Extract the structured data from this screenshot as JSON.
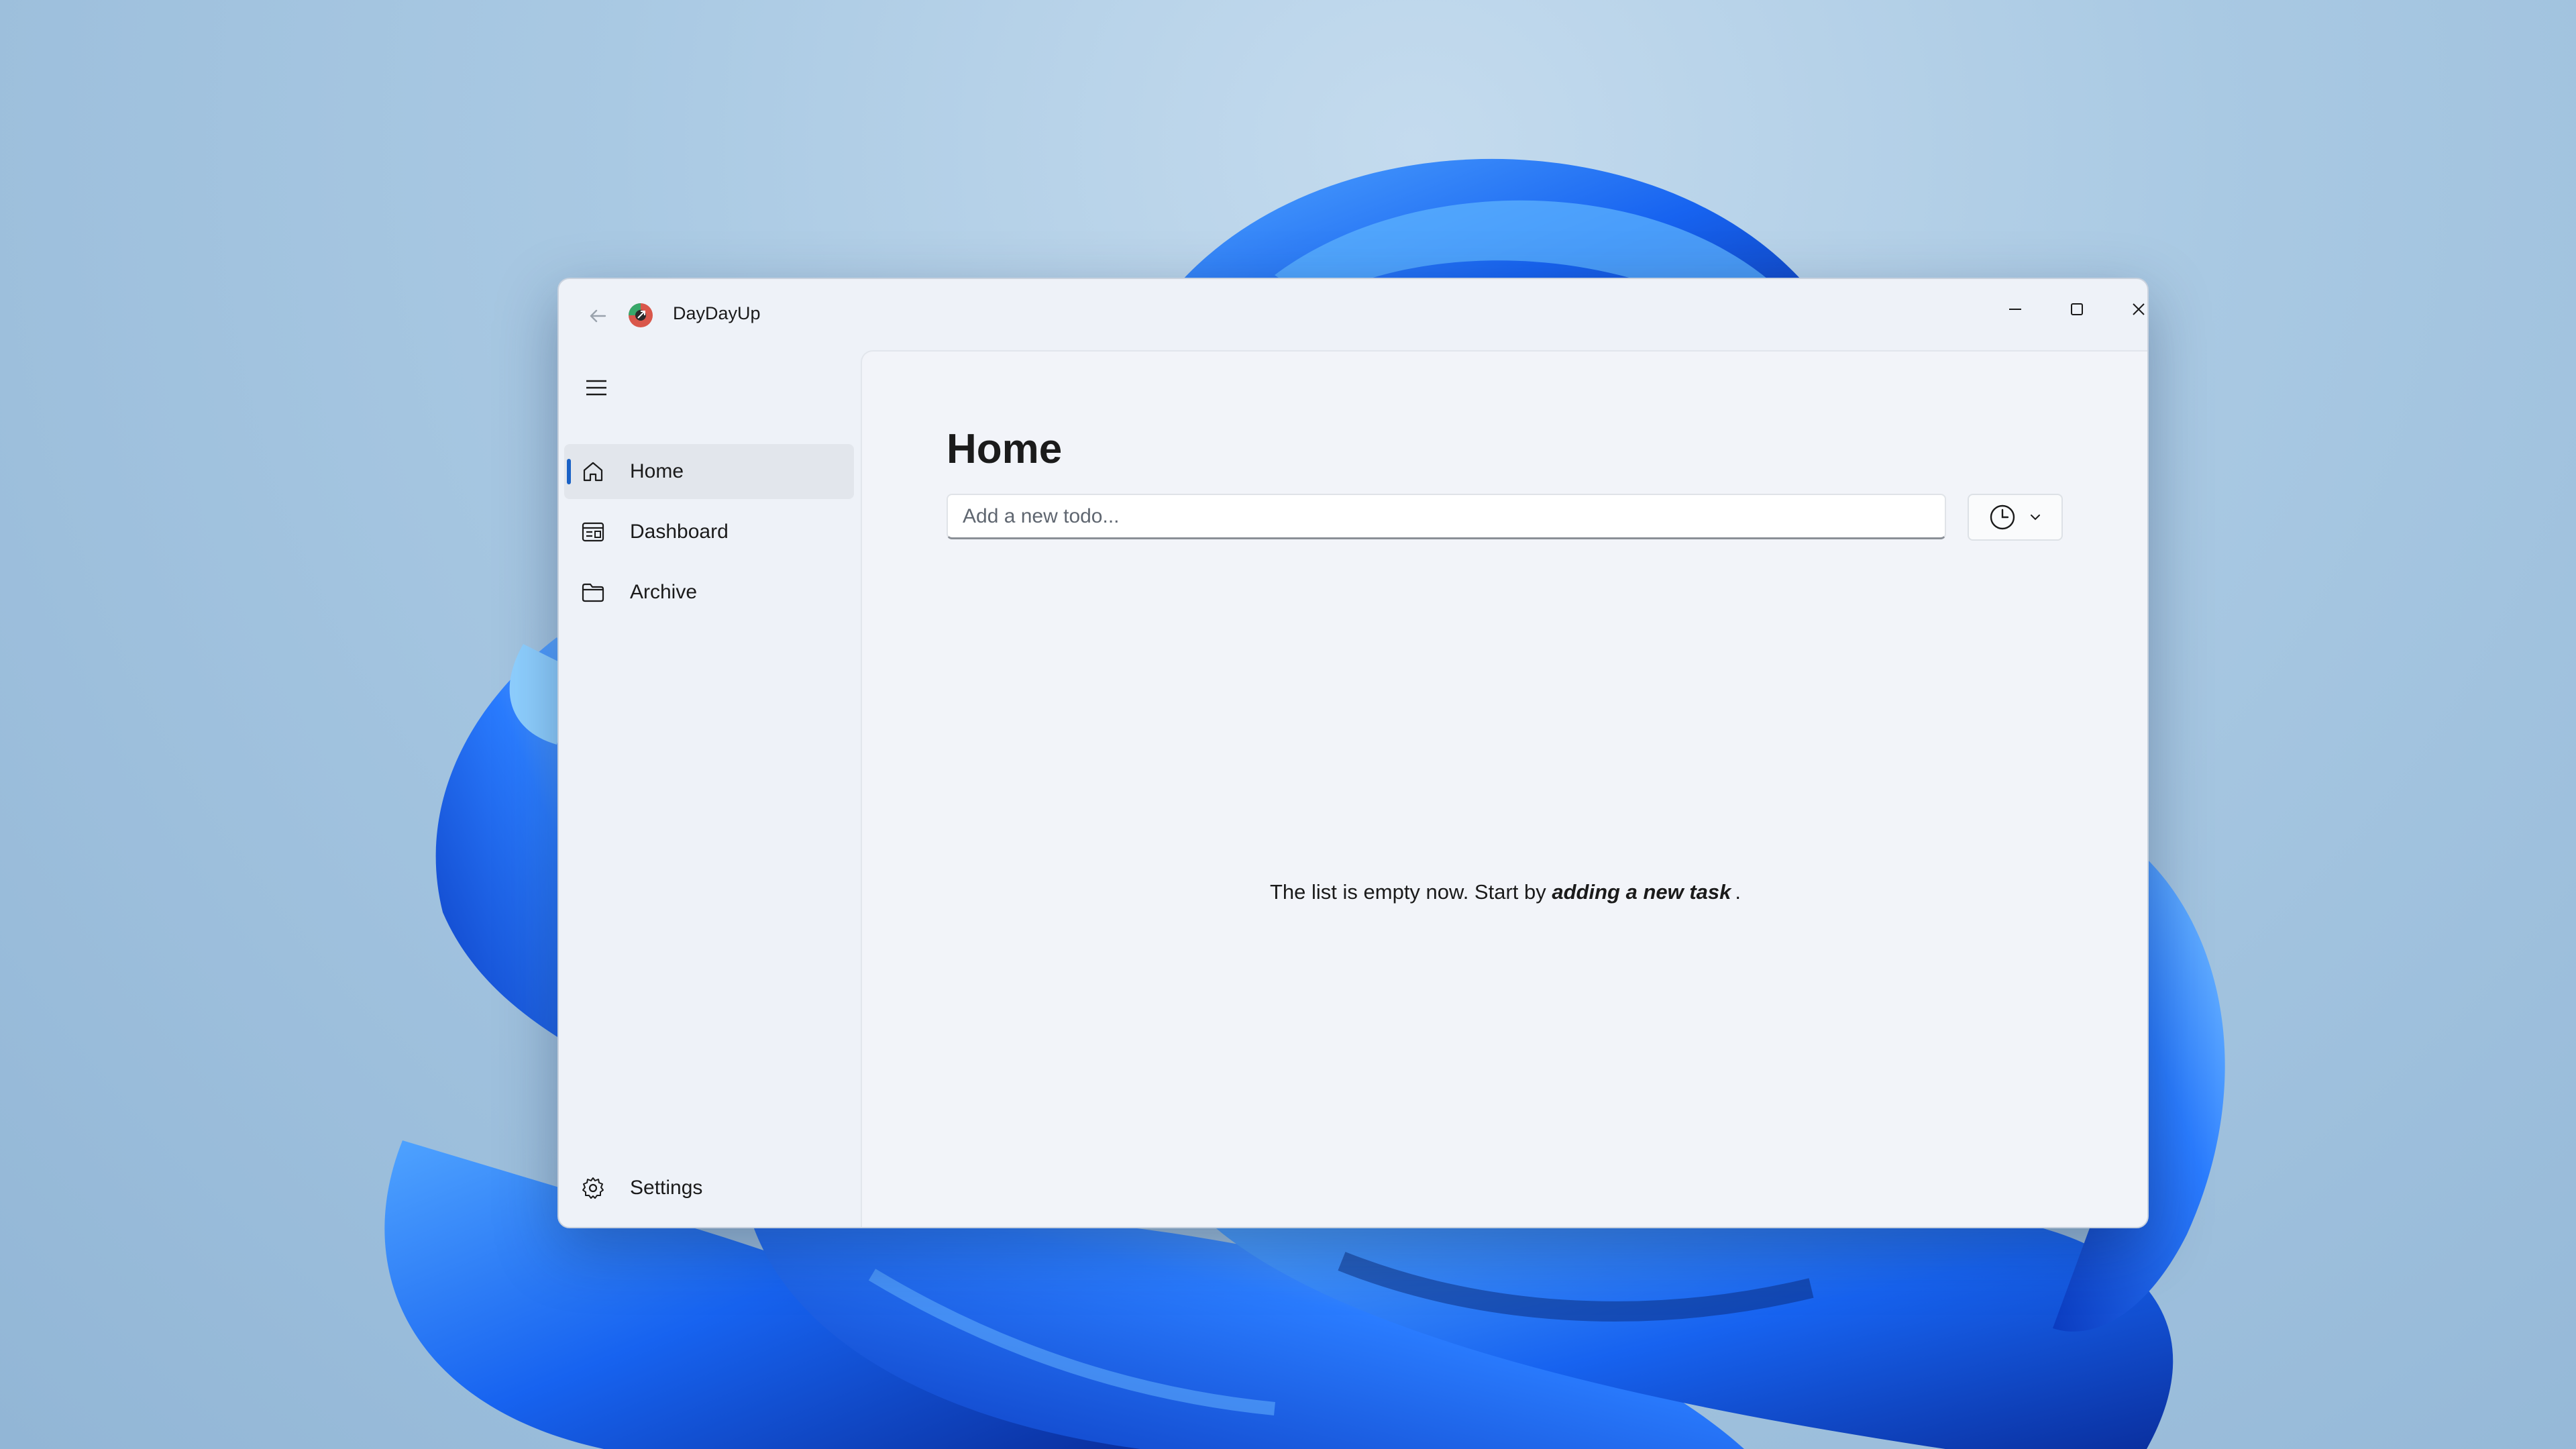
{
  "app": {
    "title": "DayDayUp"
  },
  "window_controls": {
    "minimize_icon": "minimize-icon",
    "maximize_icon": "maximize-icon",
    "close_icon": "close-icon"
  },
  "sidebar": {
    "items": [
      {
        "label": "Home",
        "icon": "home-icon",
        "active": true
      },
      {
        "label": "Dashboard",
        "icon": "dashboard-icon",
        "active": false
      },
      {
        "label": "Archive",
        "icon": "folder-icon",
        "active": false
      }
    ],
    "footer": {
      "label": "Settings",
      "icon": "gear-icon"
    }
  },
  "main": {
    "title": "Home",
    "input_placeholder": "Add a new todo...",
    "time_picker_icon": "clock-icon",
    "empty_message": {
      "prefix": "The list is empty now. Start by",
      "emphasis": "adding a new task",
      "suffix": "."
    }
  },
  "colors": {
    "accent": "#1a62c6",
    "window_bg": "#eef2f8",
    "content_bg": "#f2f4f9"
  }
}
